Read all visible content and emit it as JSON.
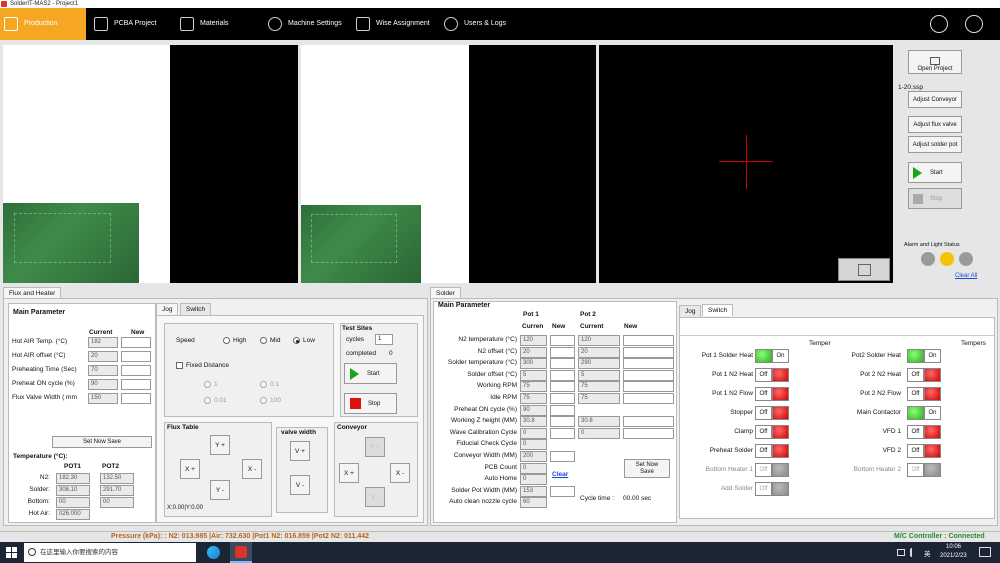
{
  "window_title": "SolderIT-MAS2 - Project1",
  "nav": {
    "production": "Production",
    "pcba_project": "PCBA Project",
    "materials": "Materials",
    "machine_settings": "Machine Settings",
    "wise_assignment": "Wise Assignment",
    "users_logs": "Users & Logs"
  },
  "right_panel": {
    "open_project": "Open Project",
    "file_name": "1-20.ssp",
    "adjust_conveyor": "Adjust Conveyor",
    "adjust_flux_valve": "Adjust flux valve",
    "adjust_solder_pot": "Adjust solder pot",
    "start": "Start",
    "stop": "Stop",
    "alarm_status": "Alarm and Light Status",
    "clear_all": "Clear All",
    "lights": [
      "#9a9a9a",
      "#f2c500",
      "#9a9a9a"
    ]
  },
  "flux": {
    "tab": "Flux and Heater",
    "main_param": "Main Parameter",
    "col_current": "Current",
    "col_new": "New",
    "rows": [
      {
        "label": "Hot AIR Temp. (°C)",
        "current": "182",
        "new": ""
      },
      {
        "label": "Hot AIR offset (°C)",
        "current": "20",
        "new": ""
      },
      {
        "label": "Preheating Time (Sec)",
        "current": "70",
        "new": ""
      },
      {
        "label": "Preheat ON cycle (%)",
        "current": "90",
        "new": ""
      },
      {
        "label": "Flux Valve Width ( mm",
        "current": "150",
        "new": ""
      }
    ],
    "set_now_save": "Set Now   Save",
    "temp_title": "Temperature (°C):",
    "pot1": "POT1",
    "pot2": "POT2",
    "temp_rows": [
      {
        "label": "N2:",
        "pot1": "182.30",
        "pot2": "132.50"
      },
      {
        "label": "Solder:",
        "pot1": "308.10",
        "pot2": "291.70"
      },
      {
        "label": "Bottom:",
        "pot1": "00",
        "pot2": "00"
      },
      {
        "label": "Hot Air:",
        "pot1": "026.000",
        "pot2": ""
      }
    ]
  },
  "jog": {
    "tab_jog": "Jog",
    "tab_switch": "Switch",
    "speed": "Speed",
    "high": "High",
    "mid": "Mid",
    "low": "Low",
    "fixed_distance": "Fixed Distance",
    "d1": "1",
    "d01": "0.1",
    "d001": "0.01",
    "d100": "100",
    "test_sites": "Test Sites",
    "cycles_label": "cycles",
    "cycles_value": "1",
    "completed_label": "completed",
    "completed_value": "0",
    "start": "Start",
    "stop": "Stop",
    "flux_table": "Flux Table",
    "valve_width": "valve width",
    "conveyor": "Conveyor",
    "yplus": "Y +",
    "yminus": "Y -",
    "xplus": "X +",
    "xminus": "X -",
    "vplus": "V +",
    "vminus": "V -",
    "coords": "X:0.00|Y:0.00"
  },
  "solder": {
    "tab": "Solder",
    "main_param": "Main Parameter",
    "pot1": "Pot 1",
    "pot2": "Pot 2",
    "current": "Curren",
    "new": "New",
    "current2": "Current",
    "new2": "New",
    "rows": [
      {
        "label": "N2 temperature (°C)",
        "p1c": "120",
        "p1n": "",
        "p2c": "120",
        "p2n": ""
      },
      {
        "label": "N2 offset (°C)",
        "p1c": "20",
        "p1n": "",
        "p2c": "20",
        "p2n": ""
      },
      {
        "label": "Solder temperature (°C)",
        "p1c": "300",
        "p1n": "",
        "p2c": "290",
        "p2n": ""
      },
      {
        "label": "Solder offset (°C)",
        "p1c": "5",
        "p1n": "",
        "p2c": "5",
        "p2n": ""
      },
      {
        "label": "Working RPM",
        "p1c": "75",
        "p1n": "",
        "p2c": "75",
        "p2n": ""
      },
      {
        "label": "Idle RPM",
        "p1c": "75",
        "p1n": "",
        "p2c": "75",
        "p2n": ""
      },
      {
        "label": "Preheat ON cycle (%)",
        "p1c": "90",
        "p1n": ""
      },
      {
        "label": "Working Z height (MM)",
        "p1c": "30.8",
        "p1n": "",
        "p2c": "30.8",
        "p2n": ""
      },
      {
        "label": "Wave Calibration Cycle",
        "p1c": "0",
        "p1n": "",
        "p2c": "0",
        "p2n": ""
      },
      {
        "label": "Fiducial Check Cycle",
        "p1c": "0"
      },
      {
        "label": "Conveyor Width (MM)",
        "p1c": "200",
        "p1n": ""
      },
      {
        "label": "PCB Count",
        "p1c": "0"
      },
      {
        "label": "Auto Home",
        "p1c": "0"
      },
      {
        "label": "Solder Pot Width (MM)",
        "p1c": "153",
        "p1n": ""
      },
      {
        "label": "Auto clean nozzle cycle",
        "p1c": "60"
      }
    ],
    "clear": "Clear",
    "set_now_save": "Set Now\nSave",
    "cycle_time_label": "Cycle time :",
    "cycle_time_value": "00.00 sec"
  },
  "switch": {
    "tab_jog": "Jog",
    "tab_switch": "Switch",
    "temper": "Temper",
    "tempers": "Tempers",
    "on": "On",
    "off": "Off",
    "left": [
      {
        "label": "Pot 1 Solder Heat",
        "text": "On",
        "light": "green"
      },
      {
        "label": "Pot 1 N2 Heat",
        "text": "Off",
        "light": "red"
      },
      {
        "label": "Pot 1 N2 Flow",
        "text": "Off",
        "light": "red"
      },
      {
        "label": "Stopper",
        "text": "Off",
        "light": "red"
      },
      {
        "label": "Clamp",
        "text": "Off",
        "light": "red"
      },
      {
        "label": "Preheat Solder",
        "text": "Off",
        "light": "red"
      },
      {
        "label": "Bottom Heater 1",
        "text": "Off",
        "light": "gray"
      },
      {
        "label": "Add Solder",
        "text": "Off",
        "light": "gray"
      }
    ],
    "right": [
      {
        "label": "Pot2 Solder Heat",
        "text": "On",
        "light": "green"
      },
      {
        "label": "Pot 2 N2 Heat",
        "text": "Off",
        "light": "red"
      },
      {
        "label": "Pot 2 N2 Flow",
        "text": "Off",
        "light": "red"
      },
      {
        "label": "Main Contactor",
        "text": "On",
        "light": "green"
      },
      {
        "label": "VFD 1",
        "text": "Off",
        "light": "red"
      },
      {
        "label": "VFD 2",
        "text": "Off",
        "light": "red"
      },
      {
        "label": "Bottom Heater 2",
        "text": "Off",
        "light": "gray"
      }
    ]
  },
  "status": {
    "pressure": "Pressure (kPa): : N2: 013.985 |Air: 732.630 |Pot1 N2: 016.859 |Pot2 N2: 011.442",
    "controller": "M/C Controller : Connected"
  },
  "taskbar": {
    "search_placeholder": "在这里输入你要搜索的内容",
    "time": "10:06",
    "date": "2021/2/23",
    "ime": "英"
  }
}
